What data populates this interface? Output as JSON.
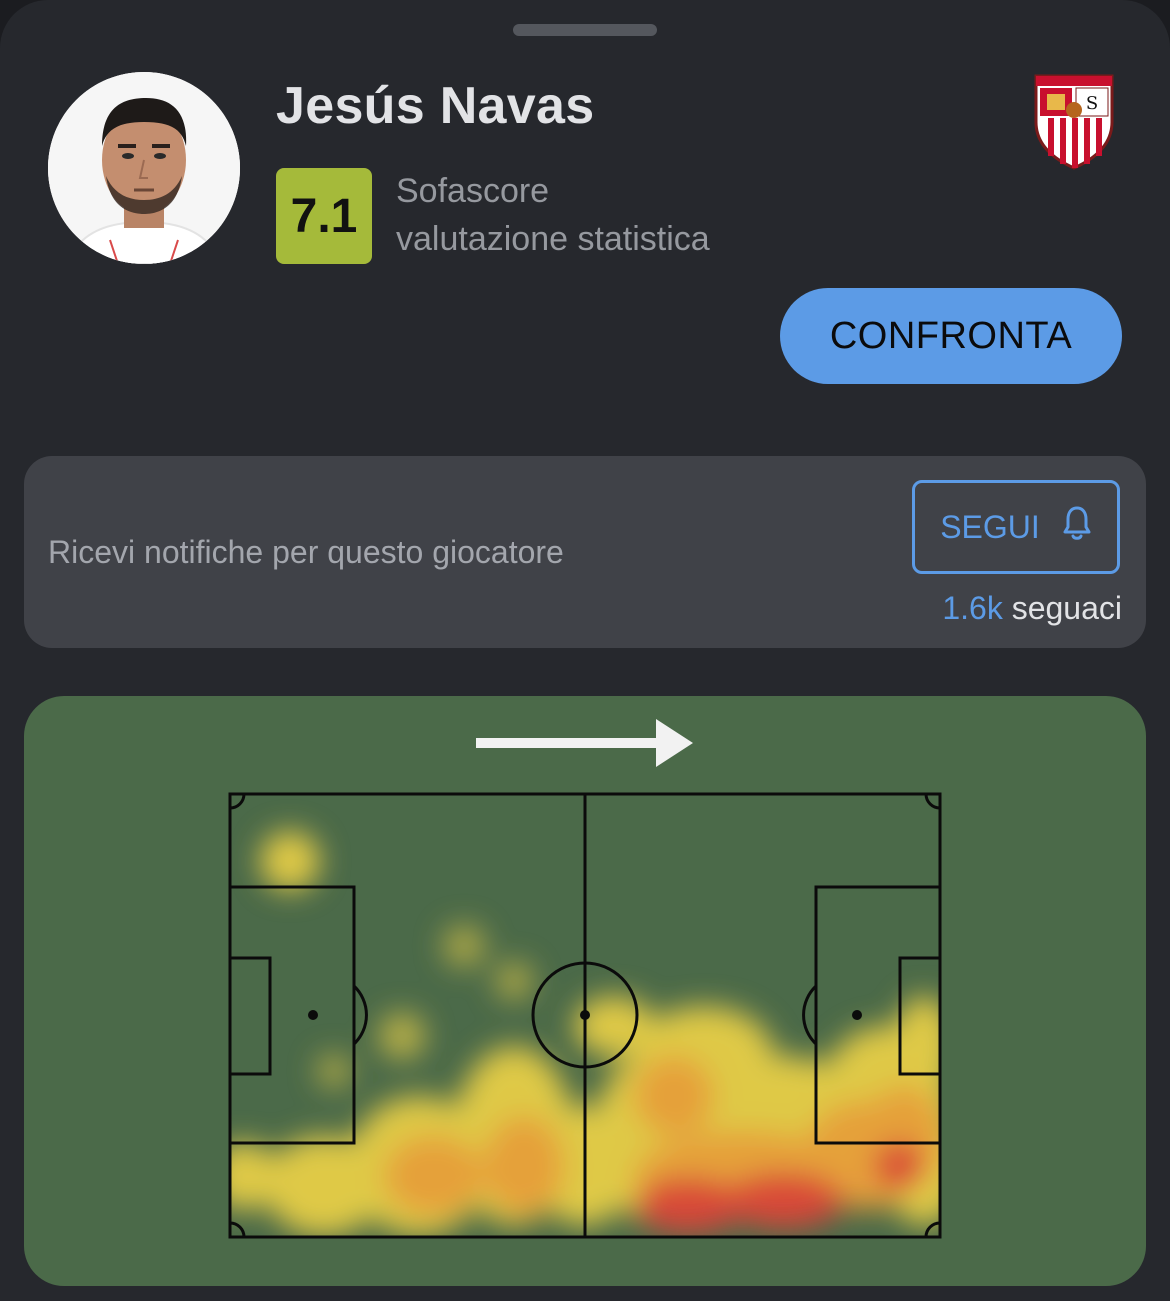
{
  "player": {
    "name": "Jesús Navas",
    "rating": "7.1",
    "rating_label_line1": "Sofascore",
    "rating_label_line2": "valutazione statistica"
  },
  "actions": {
    "compare_label": "CONFRONTA"
  },
  "follow": {
    "description": "Ricevi notifiche per questo giocatore",
    "button_label": "SEGUI",
    "followers_count": "1.6k",
    "followers_label": "seguaci"
  },
  "icons": {
    "follow": "bell-icon",
    "club": "sevilla-crest-icon",
    "direction": "arrow-right-icon"
  },
  "colors": {
    "accent": "#5c9be6",
    "rating_badge": "#a5ba3a",
    "pitch": "#4b6a49",
    "background": "#26282d",
    "card": "#404248"
  }
}
